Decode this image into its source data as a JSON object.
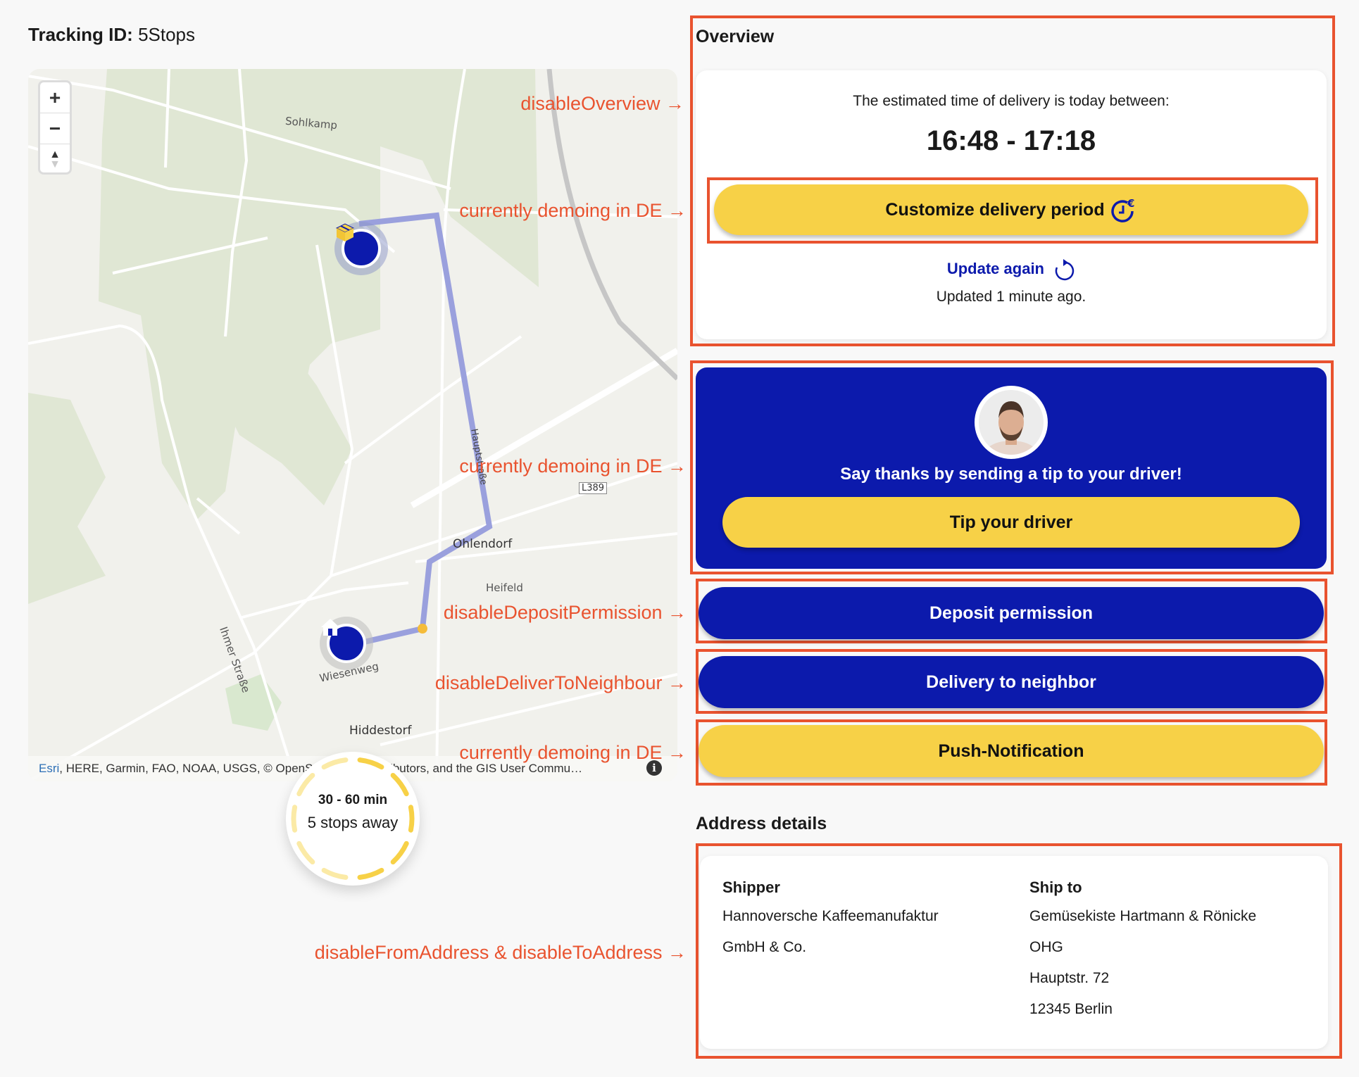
{
  "header": {
    "tracking_label": "Tracking ID",
    "tracking_value": "5Stops"
  },
  "map": {
    "place_labels": {
      "sohlkamp": "Sohlkamp",
      "ohlendorf": "Ohlendorf",
      "heifeld": "Heifeld",
      "hiddestorf": "Hiddestorf",
      "ihmer": "Ihmer Straße",
      "hauptstrasse": "Hauptstraße",
      "wiesenweg": "Wiesenweg",
      "road_shield": "L389"
    },
    "zoom_in_label": "+",
    "zoom_out_label": "−",
    "compass_up": "▲",
    "compass_down": "▼",
    "attribution_link": "Esri",
    "attribution_text": ", HERE, Garmin, FAO, NOAA, USGS, © OpenStreetMap contributors, and the GIS User Commu…",
    "info_label": "i",
    "markers": [
      {
        "type": "package",
        "icon": "package-icon"
      },
      {
        "type": "home",
        "icon": "home-icon"
      }
    ]
  },
  "eta_ring": {
    "time_range": "30 - 60 min",
    "stops_text": "5 stops away",
    "segments_total": 10,
    "segments_done": 5,
    "color_done": "#f7d147",
    "color_pending": "#fbeaa6"
  },
  "annotations": {
    "overview": "disableOverview →",
    "customize": "currently demoing in DE →",
    "tip": "currently demoing in DE →",
    "deposit": "disableDepositPermission →",
    "neighbor": "disableDeliverToNeighbour →",
    "push": "currently demoing in DE →",
    "address": "disableFromAddress & disableToAddress →"
  },
  "overview": {
    "title": "Overview",
    "eta_text": "The estimated time of delivery is today between:",
    "eta_time": "16:48 - 17:18",
    "customize_label": "Customize delivery period",
    "update_label": "Update again",
    "updated_text": "Updated 1 minute ago."
  },
  "tip": {
    "message": "Say thanks by sending a tip to your driver!",
    "button_label": "Tip your driver"
  },
  "actions": {
    "deposit_label": "Deposit permission",
    "neighbor_label": "Delivery to neighbor",
    "push_label": "Push-Notification"
  },
  "address": {
    "title": "Address details",
    "shipper": {
      "heading": "Shipper",
      "lines": [
        "Hannoversche Kaffeemanufaktur",
        "GmbH & Co."
      ]
    },
    "ship_to": {
      "heading": "Ship to",
      "lines": [
        "Gemüsekiste Hartmann & Rönicke",
        "OHG",
        "Hauptstr. 72",
        "12345 Berlin"
      ]
    }
  },
  "colors": {
    "brand_blue": "#0c1aac",
    "brand_yellow": "#f7d147",
    "annotation_red": "#e9532f",
    "route": "#9aa0dd"
  }
}
